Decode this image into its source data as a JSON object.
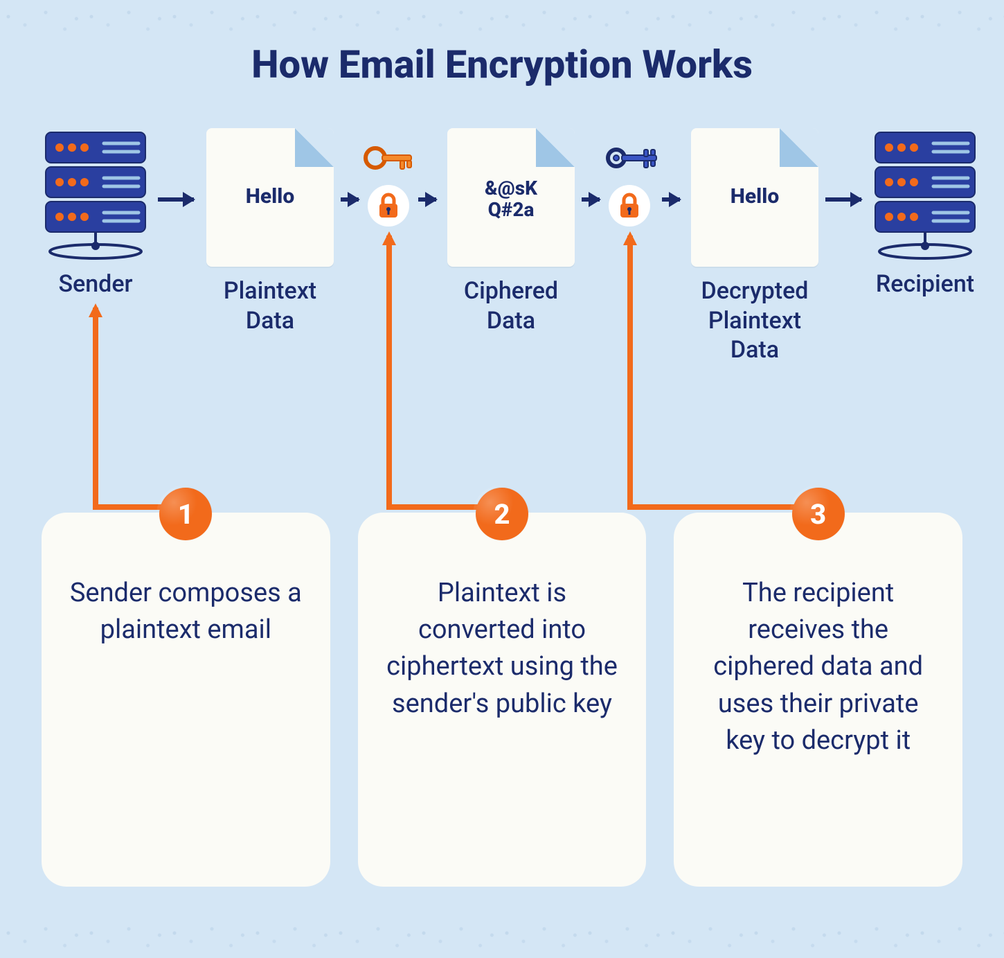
{
  "title": "How Email Encryption Works",
  "flow": {
    "sender_label": "Sender",
    "plaintext_label": "Plaintext\nData",
    "plaintext_content": "Hello",
    "ciphered_label": "Ciphered\nData",
    "ciphered_content": "&@sK\nQ#2a",
    "decrypted_label": "Decrypted\nPlaintext\nData",
    "decrypted_content": "Hello",
    "recipient_label": "Recipient"
  },
  "steps": [
    {
      "num": "1",
      "text": "Sender composes a plaintext email"
    },
    {
      "num": "2",
      "text": "Plaintext is converted into ciphertext using the sender's public key"
    },
    {
      "num": "3",
      "text": "The recipient receives the ciphered data and uses their private key to decrypt it"
    }
  ],
  "colors": {
    "navy": "#1b2b6b",
    "orange": "#f26a1b",
    "bg": "#d4e6f5",
    "card": "#fbfbf6",
    "docfold": "#9fc6e6"
  }
}
